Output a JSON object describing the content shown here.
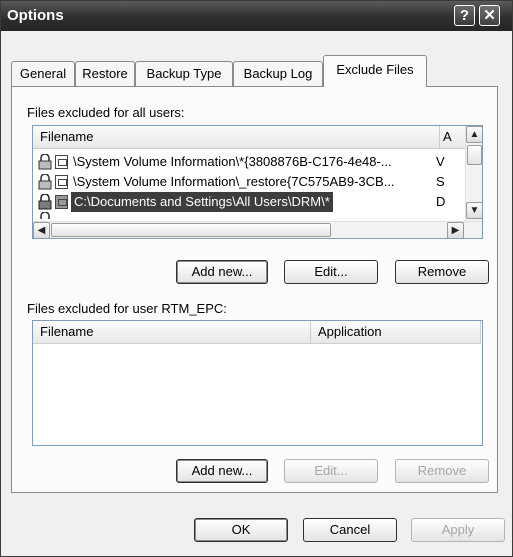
{
  "window": {
    "title": "Options",
    "help_glyph": "?",
    "close_glyph": "✕"
  },
  "tabs": [
    {
      "label": "General"
    },
    {
      "label": "Restore"
    },
    {
      "label": "Backup Type"
    },
    {
      "label": "Backup Log"
    },
    {
      "label": "Exclude Files",
      "active": true
    }
  ],
  "all_users": {
    "label": "Files excluded for all users:",
    "columns": [
      "Filename",
      "A"
    ],
    "rows": [
      {
        "filename": "\\System Volume Information\\*{3808876B-C176-4e48-...",
        "app": "V"
      },
      {
        "filename": "\\System Volume Information\\_restore{7C575AB9-3CB...",
        "app": "S"
      },
      {
        "filename": "C:\\Documents and Settings\\All Users\\DRM\\*",
        "app": "D",
        "selected": true
      }
    ],
    "buttons": {
      "add": "Add new...",
      "edit": "Edit...",
      "remove": "Remove"
    }
  },
  "user": {
    "label": "Files excluded for user RTM_EPC:",
    "columns": [
      "Filename",
      "Application"
    ],
    "buttons": {
      "add": "Add new...",
      "edit": "Edit...",
      "remove": "Remove"
    }
  },
  "footer": {
    "ok": "OK",
    "cancel": "Cancel",
    "apply": "Apply"
  },
  "scroll_glyphs": {
    "up": "▲",
    "down": "▼",
    "left": "◀",
    "right": "▶"
  }
}
